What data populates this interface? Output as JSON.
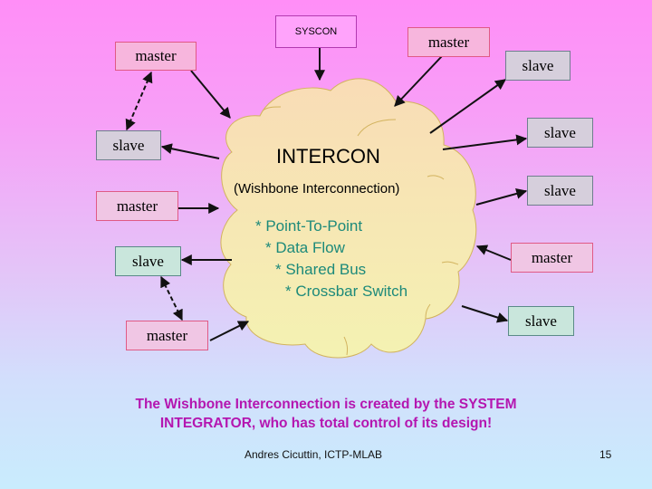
{
  "slide": {
    "syscon_label": "SYSCON",
    "cloud": {
      "title": "INTERCON",
      "subtitle": "(Wishbone Interconnection)",
      "features": [
        "* Point-To-Point",
        "* Data Flow",
        "* Shared Bus",
        "* Crossbar Switch"
      ]
    },
    "nodes": {
      "master_top_left": "master",
      "master_top_right": "master",
      "slave_top_right": "slave",
      "slave_left_1": "slave",
      "slave_right_1": "slave",
      "master_left_2": "master",
      "slave_right_2": "slave",
      "slave_left_3": "slave",
      "master_right_3": "master",
      "master_left_4": "master",
      "slave_right_4": "slave"
    },
    "note_line1": "The Wishbone Interconnection is created by the SYSTEM",
    "note_line2": "INTEGRATOR, who has total control of its design!",
    "author": "Andres Cicuttin, ICTP-MLAB",
    "page_number": "15",
    "colors": {
      "note_text": "#b416b0",
      "feature_text": "#1d8a7a",
      "cloud_fill": "#f8e8b0",
      "cloud_stroke": "#d4b460"
    }
  }
}
